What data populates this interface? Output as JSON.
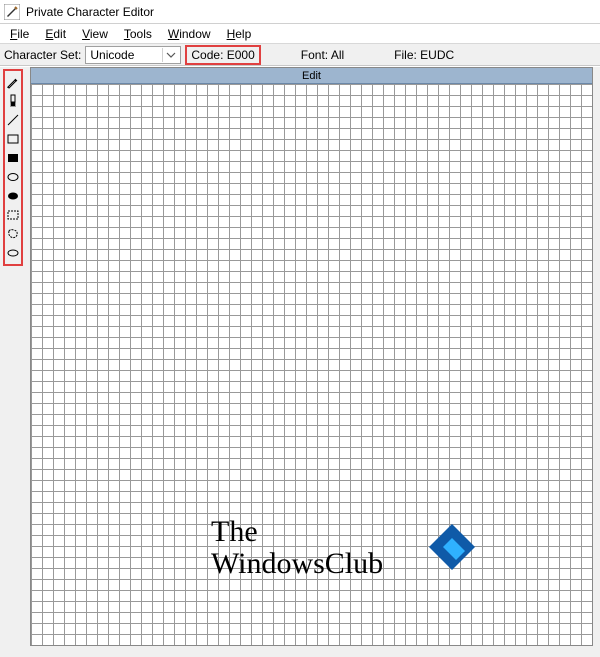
{
  "title": "Private Character Editor",
  "menu": {
    "file": "File",
    "edit": "Edit",
    "view": "View",
    "tools": "Tools",
    "window": "Window",
    "help": "Help"
  },
  "info": {
    "charset_label": "Character Set:",
    "charset_value": "Unicode",
    "code_label": "Code:",
    "code_value": "E000",
    "font_label": "Font:",
    "font_value": "All",
    "file_label": "File:",
    "file_value": "EUDC"
  },
  "edit_window_title": "Edit",
  "watermark_line1": "The",
  "watermark_line2": "WindowsClub",
  "tools": {
    "pencil": "pencil",
    "brush": "brush",
    "line": "line",
    "rect_hollow": "hollow-rectangle",
    "rect_filled": "filled-rectangle",
    "ellipse_hollow": "hollow-ellipse",
    "ellipse_filled": "filled-ellipse",
    "rect_select": "rectangular-selection",
    "free_select": "freeform-selection",
    "eraser": "eraser"
  },
  "colors": {
    "highlight_border": "#e04040",
    "edit_titlebar": "#9db5cf"
  }
}
